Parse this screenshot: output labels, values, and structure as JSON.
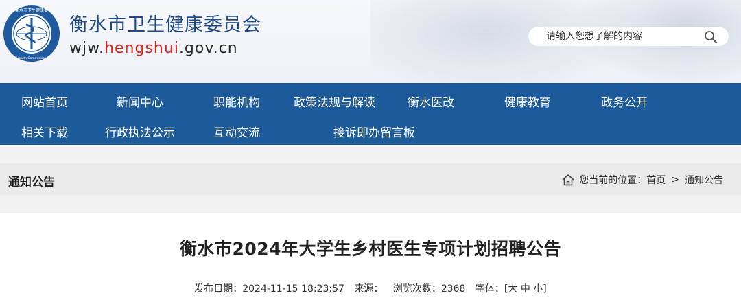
{
  "header": {
    "title": "衡水市卫生健康委员会",
    "domain_prefix": "wjw.",
    "domain_highlight": "hengshui",
    "domain_suffix": ".gov.cn",
    "emblem_text": "衡水市卫生健康委员会 · Health Commission Of Hengshui",
    "search_placeholder": "请输入您想了解的内容"
  },
  "nav": {
    "items": [
      {
        "label": "网站首页"
      },
      {
        "label": "新闻中心"
      },
      {
        "label": "职能机构"
      },
      {
        "label": "政策法规与解读"
      },
      {
        "label": "衡水医改"
      },
      {
        "label": "健康教育"
      },
      {
        "label": "政务公开"
      },
      {
        "label": "相关下载"
      },
      {
        "label": "行政执法公示"
      },
      {
        "label": "互动交流"
      },
      {
        "label": "接诉即办留言板"
      }
    ]
  },
  "section": {
    "title": "通知公告",
    "breadcrumb_prefix": "您当前的位置：",
    "breadcrumb_home": "首页",
    "breadcrumb_sep": ">",
    "breadcrumb_current": "通知公告"
  },
  "article": {
    "title": "衡水市2024年大学生乡村医生专项计划招聘公告",
    "publish_label": "发布日期：",
    "publish_date": "2024-11-15  18:23:57",
    "source_label": "来源：",
    "views_label": "浏览次数：",
    "views": "2368",
    "font_label": "字体：",
    "font_open": "[",
    "font_large": "大",
    "font_medium": "中",
    "font_small": "小",
    "font_close": "]"
  },
  "colors": {
    "nav_bg": "#1c5a99",
    "title_blue": "#1f4a86",
    "domain_red": "#d8231f"
  }
}
